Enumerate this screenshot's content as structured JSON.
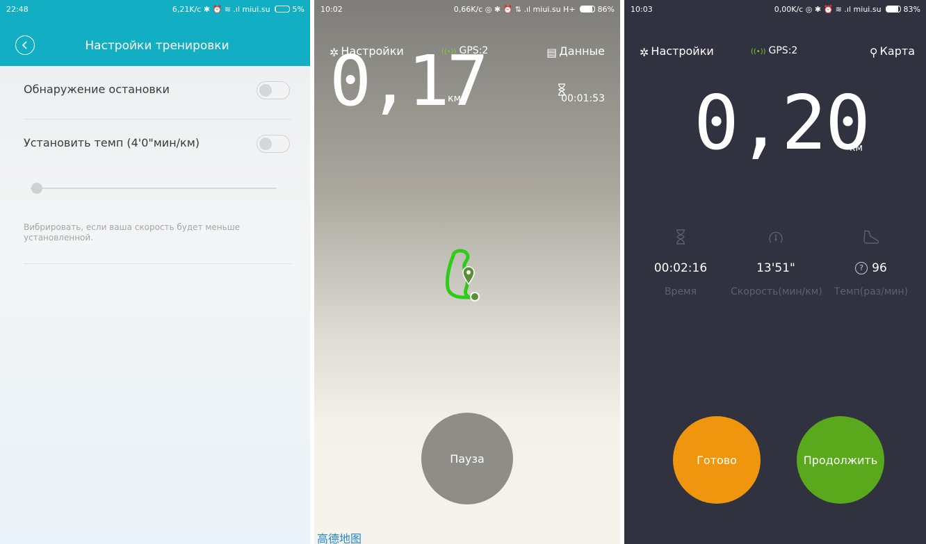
{
  "panel1": {
    "status": {
      "time": "22:48",
      "right": "6,21K/c ✱ ⏰ ≋ .ıl miui.su",
      "battery_percent": "5%",
      "battery_level": 5
    },
    "title": "Настройки тренировки",
    "settings": [
      {
        "label": "Обнаружение остановки",
        "enabled": false
      },
      {
        "label": "Установить темп (4'0\"мин/км)",
        "enabled": false
      }
    ],
    "hint": "Вибрировать, если ваша скорость будет меньше установленной.",
    "colors": {
      "header": "#12aec3"
    }
  },
  "panel2": {
    "status": {
      "time": "10:02",
      "right": "0,66K/c ◎ ✱ ⏰ ⇅ .ıl miui.su H+",
      "battery_percent": "86%",
      "battery_level": 86
    },
    "settings_label": "Настройки",
    "gps": "GPS:2",
    "data_label": "Данные",
    "distance": "0,17",
    "unit": "км",
    "timer": "00:01:53",
    "pause_label": "Пауза",
    "map_logo": "高德地图",
    "colors": {
      "route": "#2ecc17",
      "pause": "#8f8d88"
    }
  },
  "panel3": {
    "status": {
      "time": "10:03",
      "right": "0,00K/c ◎ ✱ ⏰ ≋ .ıl miui.su",
      "battery_percent": "83%",
      "battery_level": 83
    },
    "settings_label": "Настройки",
    "gps": "GPS:2",
    "map_label": "Карта",
    "distance": "0,20",
    "unit": "км",
    "stats": [
      {
        "icon": "hourglass-icon",
        "value": "00:02:16",
        "label": "Время"
      },
      {
        "icon": "speedometer-icon",
        "value": "13'51\"",
        "label": "Скорость(мин/км)"
      },
      {
        "icon": "shoe-icon",
        "value": "96",
        "label": "Темп(раз/мин)"
      }
    ],
    "done_label": "Готово",
    "resume_label": "Продолжить",
    "colors": {
      "done": "#f0960e",
      "resume": "#5aa81b",
      "background": "#30323f"
    }
  }
}
